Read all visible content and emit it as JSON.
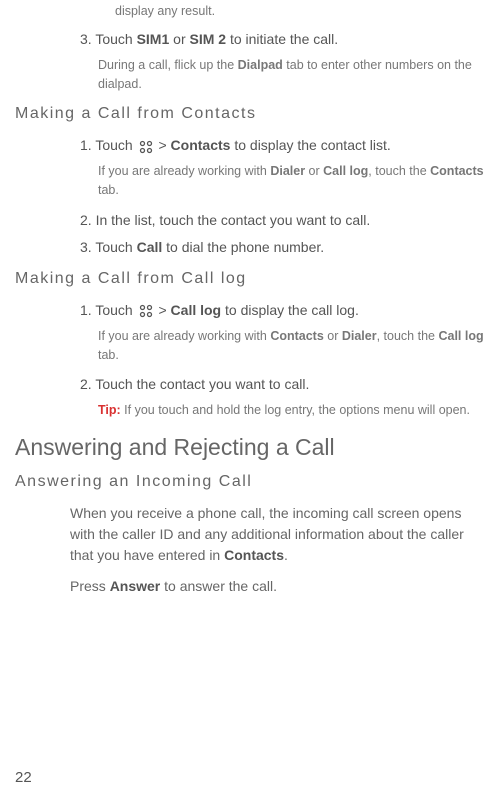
{
  "top_note": "display any result.",
  "step3": {
    "num": "3.",
    "pre": "Touch ",
    "sim1": "SIM1",
    "or": " or ",
    "sim2": "SIM 2",
    "post": " to initiate the call.",
    "note_pre": "During a call, flick up the ",
    "note_bold": "Dialpad",
    "note_post": " tab to enter other numbers on the dialpad."
  },
  "contacts": {
    "heading": "Making a Call from Contacts",
    "s1": {
      "num": "1.",
      "pre": "Touch ",
      "gt": " > ",
      "bold1": "Contacts",
      "post": " to display the contact list.",
      "note_pre": "If you are already working with ",
      "note_b1": "Dialer",
      "note_mid1": " or ",
      "note_b2": "Call log",
      "note_mid2": ", touch the ",
      "note_b3": "Contacts",
      "note_post": " tab."
    },
    "s2": {
      "num": "2.",
      "text": "In the list, touch the contact you want to call."
    },
    "s3": {
      "num": "3.",
      "pre": "Touch ",
      "bold": "Call",
      "post": " to dial the phone number."
    }
  },
  "calllog": {
    "heading": "Making a Call from Call log",
    "s1": {
      "num": "1.",
      "pre": "Touch ",
      "gt": " > ",
      "bold1": "Call log",
      "post": " to display the call log.",
      "note_pre": "If you are already working with ",
      "note_b1": "Contacts",
      "note_mid1": " or ",
      "note_b2": "Dialer",
      "note_mid2": ", touch the ",
      "note_b3": "Call log",
      "note_post": " tab."
    },
    "s2": {
      "num": "2.",
      "text": "Touch the contact you want to call."
    },
    "tip": {
      "label": "Tip:  ",
      "text": "If you touch and hold the log entry, the options menu will open."
    }
  },
  "answer": {
    "h2": "Answering and Rejecting a Call",
    "h3": "Answering an Incoming Call",
    "p1_pre": "When you receive a phone call, the incoming call screen opens with the caller ID and any additional information about the caller that you have entered in ",
    "p1_bold": "Contacts",
    "p1_post": ".",
    "p2_pre": "Press ",
    "p2_bold": "Answer",
    "p2_post": " to answer the call."
  },
  "page_number": "22",
  "icons": {
    "apps": "apps-grid-icon"
  }
}
